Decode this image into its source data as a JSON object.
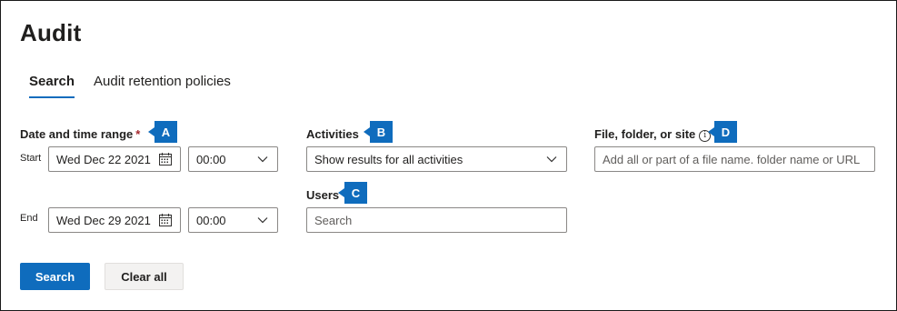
{
  "page": {
    "title": "Audit"
  },
  "tabs": [
    {
      "label": "Search",
      "active": true
    },
    {
      "label": "Audit retention policies",
      "active": false
    }
  ],
  "date_range": {
    "label": "Date and time range",
    "required_mark": "*",
    "callout": "A",
    "start": {
      "label": "Start",
      "date": "Wed Dec 22 2021",
      "time": "00:00"
    },
    "end": {
      "label": "End",
      "date": "Wed Dec 29 2021",
      "time": "00:00"
    }
  },
  "activities": {
    "label": "Activities",
    "callout": "B",
    "value": "Show results for all activities"
  },
  "users": {
    "label": "Users",
    "callout": "C",
    "placeholder": "Search"
  },
  "file_site": {
    "label": "File, folder, or site",
    "info_glyph": "i",
    "callout": "D",
    "placeholder": "Add all or part of a file name. folder name or URL"
  },
  "actions": {
    "search_label": "Search",
    "clear_label": "Clear all"
  },
  "colors": {
    "accent": "#0f6cbd",
    "required": "#a4262c",
    "secondary_button": "#f3f2f1"
  },
  "icons": {
    "calendar": "calendar-icon",
    "chevron": "chevron-down-icon",
    "info": "info-icon"
  }
}
